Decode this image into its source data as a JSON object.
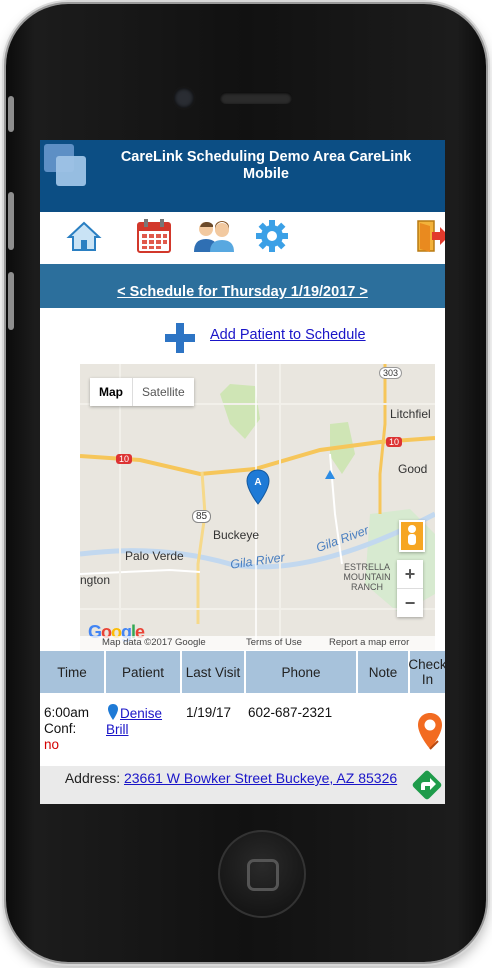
{
  "app": {
    "title": "CareLink Scheduling Demo Area CareLink Mobile"
  },
  "nav": {
    "icons": [
      "home-icon",
      "calendar-icon",
      "users-icon",
      "gear-icon",
      "logout-icon"
    ]
  },
  "schedule": {
    "header": "< Schedule for Thursday 1/19/2017 >",
    "add_label": "Add Patient to Schedule"
  },
  "map": {
    "type_map": "Map",
    "type_satellite": "Satellite",
    "marker_label": "A",
    "places": {
      "litchfield": "Litchfiel",
      "goodyear": "Good",
      "buckeye": "Buckeye",
      "palo_verde": "Palo Verde",
      "arlington": "ngton",
      "estrella": "ESTRELLA MOUNTAIN RANCH",
      "gila_river_1": "Gila River",
      "gila_river_2": "Gila River",
      "i10_left": "10",
      "i10_right": "10",
      "rt85": "85",
      "rt303": "303"
    },
    "logo": "Google",
    "footer": {
      "data": "Map data ©2017 Google",
      "terms": "Terms of Use",
      "report": "Report a map error"
    },
    "zoom_in": "+",
    "zoom_out": "−"
  },
  "table": {
    "headers": [
      "Time",
      "Patient",
      "Last Visit",
      "Phone",
      "Note",
      "Check In"
    ],
    "rows": [
      {
        "time": "6:00am",
        "conf_label": "Conf:",
        "conf_value": "no",
        "patient": "Denise Brill",
        "last_visit": "1/19/17",
        "phone": "602-687-2321",
        "note": ""
      }
    ],
    "address_label": "Address:",
    "address": "23661 W Bowker Street Buckeye, AZ 85326"
  },
  "colors": {
    "header_bg": "#0c4e84",
    "date_bar": "#2c6f9c",
    "table_header": "#a7c2db",
    "link": "#1a15c8",
    "conf_no": "#d40000",
    "checkin_orange": "#f26b21",
    "directions_green": "#1e9b4a"
  }
}
